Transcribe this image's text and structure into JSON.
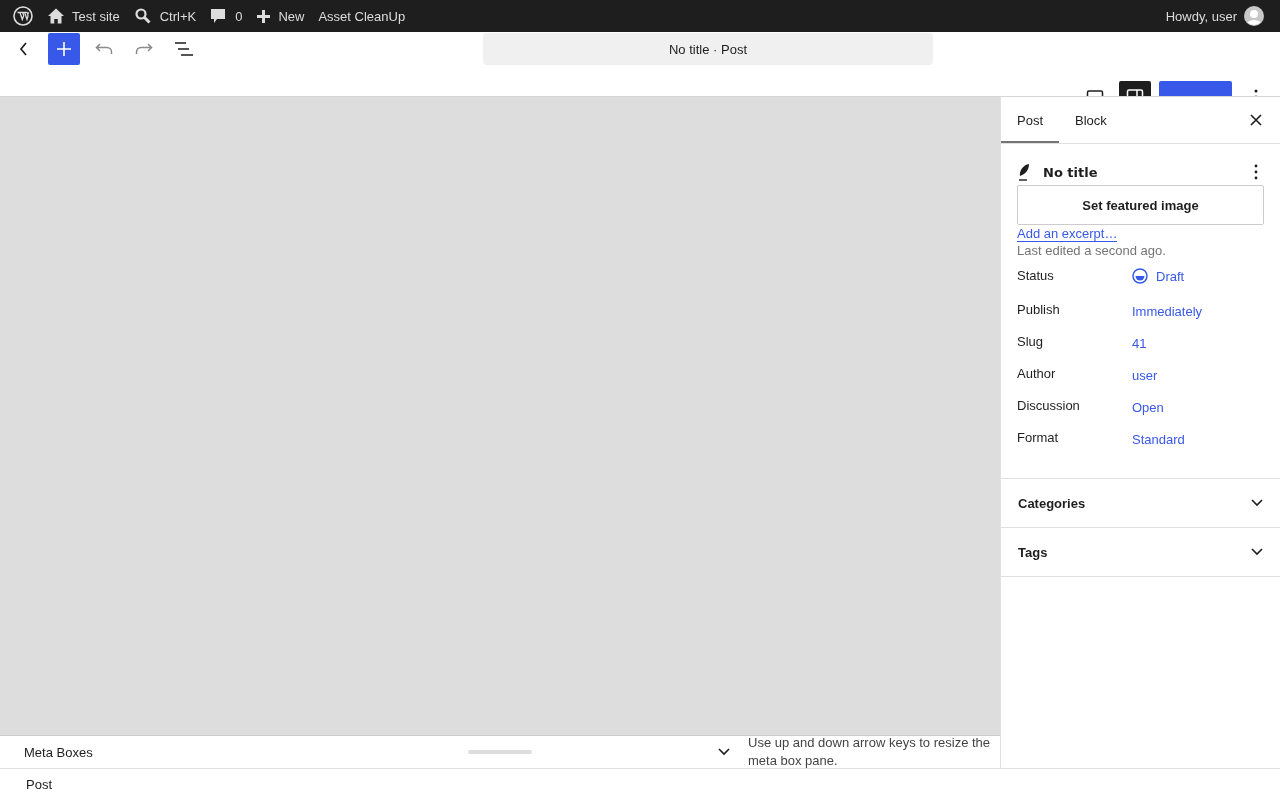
{
  "admin_bar": {
    "items": [
      {
        "kind": "logo"
      },
      {
        "kind": "site",
        "label": "Test site"
      },
      {
        "kind": "search",
        "label": "Ctrl+K"
      },
      {
        "kind": "comments",
        "label": "0"
      },
      {
        "kind": "new",
        "label": "New"
      },
      {
        "kind": "plain",
        "label": "Asset CleanUp"
      }
    ],
    "greeting": "Howdy, user"
  },
  "header": {
    "title": "No title · Post",
    "settings_pressed": true
  },
  "sidebar": {
    "tabs": [
      {
        "label": "Post",
        "selected": true
      },
      {
        "label": "Block",
        "selected": false
      }
    ],
    "post_title": "No title",
    "featured_button": "Set featured image",
    "excerpt_link": "Add an excerpt…",
    "last_edited": "Last edited a second ago.",
    "fields": [
      {
        "kind": "status",
        "label": "Status",
        "value": "Draft"
      },
      {
        "kind": "link",
        "label": "Publish",
        "value": "Immediately"
      },
      {
        "kind": "link",
        "label": "Slug",
        "value": "41"
      },
      {
        "kind": "link",
        "label": "Author",
        "value": "user"
      },
      {
        "kind": "link",
        "label": "Discussion",
        "value": "Open"
      },
      {
        "kind": "link",
        "label": "Format",
        "value": "Standard"
      }
    ],
    "panels": [
      {
        "title": "Categories",
        "expanded": false
      },
      {
        "title": "Tags",
        "expanded": false
      }
    ]
  },
  "meta_boxes": {
    "title": "Meta Boxes",
    "hint": "Use up and down arrow keys to resize the meta box pane."
  },
  "footer": {
    "breadcrumb": "Post"
  }
}
